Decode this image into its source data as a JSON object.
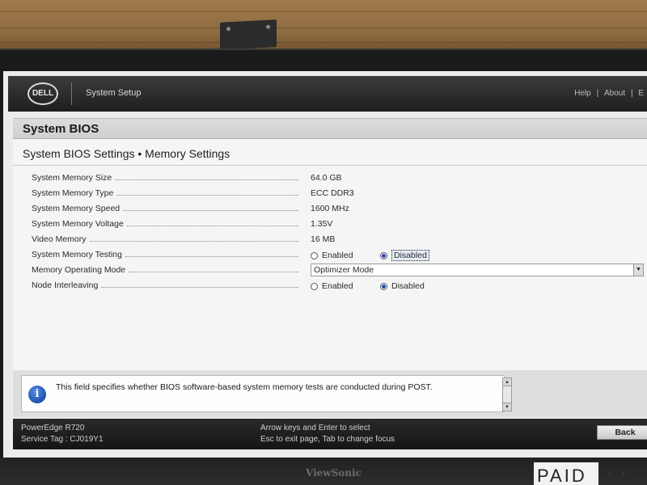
{
  "header": {
    "logo": "DELL",
    "app_title": "System Setup",
    "links": [
      "Help",
      "|",
      "About",
      "|",
      "E"
    ]
  },
  "page": {
    "title": "System BIOS",
    "subtitle": "System BIOS Settings • Memory Settings"
  },
  "settings": [
    {
      "label": "System Memory Size",
      "type": "text",
      "value": "64.0 GB"
    },
    {
      "label": "System Memory Type",
      "type": "text",
      "value": "ECC DDR3"
    },
    {
      "label": "System Memory Speed",
      "type": "text",
      "value": "1600 MHz"
    },
    {
      "label": "System Memory Voltage",
      "type": "text",
      "value": "1.35V"
    },
    {
      "label": "Video Memory",
      "type": "text",
      "value": "16 MB"
    },
    {
      "label": "System Memory Testing",
      "type": "radio",
      "options": [
        "Enabled",
        "Disabled"
      ],
      "selected": "Disabled"
    },
    {
      "label": "Memory Operating Mode",
      "type": "dropdown",
      "value": "Optimizer Mode"
    },
    {
      "label": "Node Interleaving",
      "type": "radio",
      "options": [
        "Enabled",
        "Disabled"
      ],
      "selected": "Disabled"
    }
  ],
  "help": {
    "icon": "info-icon",
    "text": "This field specifies whether BIOS software-based system memory tests are conducted during POST."
  },
  "footer": {
    "model": "PowerEdge R720",
    "service_tag": "Service Tag : CJ019Y1",
    "hint_line1": "Arrow keys and Enter to select",
    "hint_line2": "Esc to exit page, Tab to change focus",
    "back_label": "Back"
  },
  "monitor": {
    "brand": "ViewSonic",
    "sticker": "PAID"
  },
  "colors": {
    "radio_selected": "#2348c0",
    "header_bg": "#1e1e1e",
    "footer_bg": "#151515"
  }
}
